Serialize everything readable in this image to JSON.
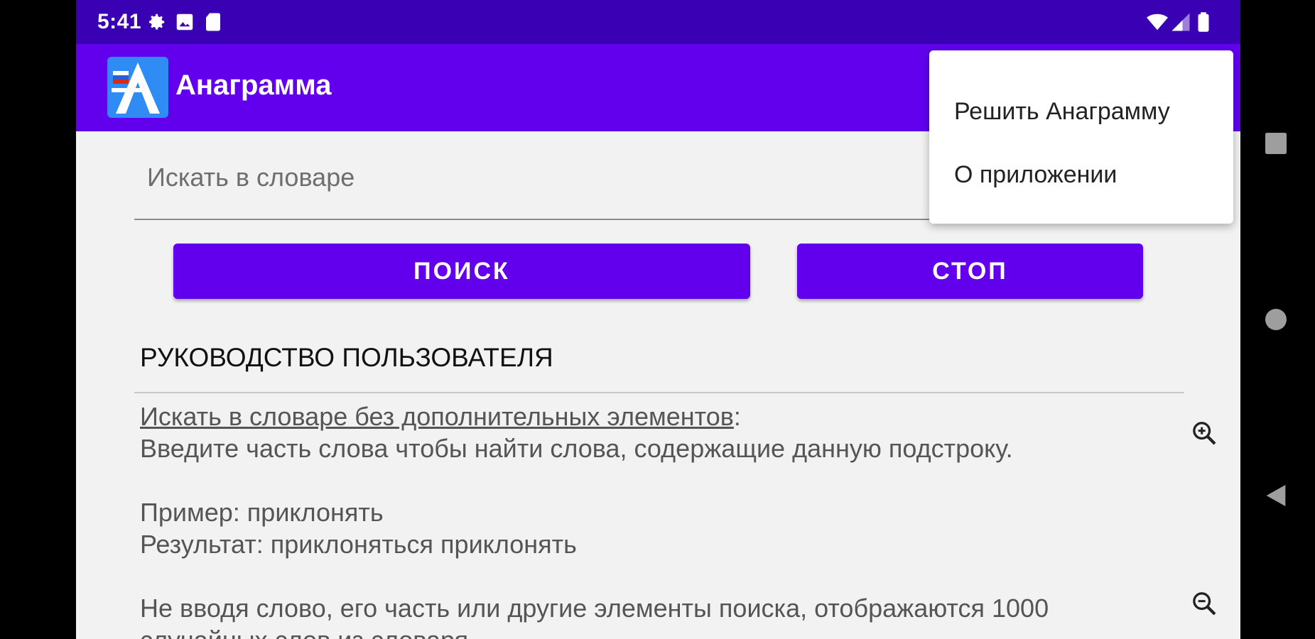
{
  "status_bar": {
    "time": "5:41",
    "icons": [
      "gear-icon",
      "image-icon",
      "sd-card-icon",
      "wifi-icon",
      "signal-icon",
      "battery-icon"
    ]
  },
  "app_bar": {
    "title": "Анаграмма",
    "logo_icon": "anagram-logo-icon"
  },
  "search": {
    "placeholder": "Искать в словаре",
    "value": ""
  },
  "buttons": {
    "search_label": "ПОИСК",
    "stop_label": "СТОП"
  },
  "guide": {
    "title": "РУКОВОДСТВО ПОЛЬЗОВАТЕЛЯ",
    "heading": "Искать в словаре без дополнительных элементов",
    "heading_suffix": ":",
    "line1": "Введите часть слова чтобы найти слова, содержащие данную подстроку.",
    "example": "Пример: приклонять",
    "result": "Результат: приклоняться приклонять",
    "line_partial": "Не вводя слово, его часть или другие элементы поиска, отображаются 1000",
    "line_partial_cut": "случайных слов из словаря"
  },
  "menu": {
    "items": [
      "Решить Анаграмму",
      "О приложении"
    ]
  },
  "colors": {
    "status_bar": "#3a00b3",
    "primary": "#6200ee",
    "background": "#f2f2f2"
  },
  "nav": {
    "icons": [
      "recents-square-icon",
      "home-circle-icon",
      "back-triangle-icon"
    ]
  }
}
